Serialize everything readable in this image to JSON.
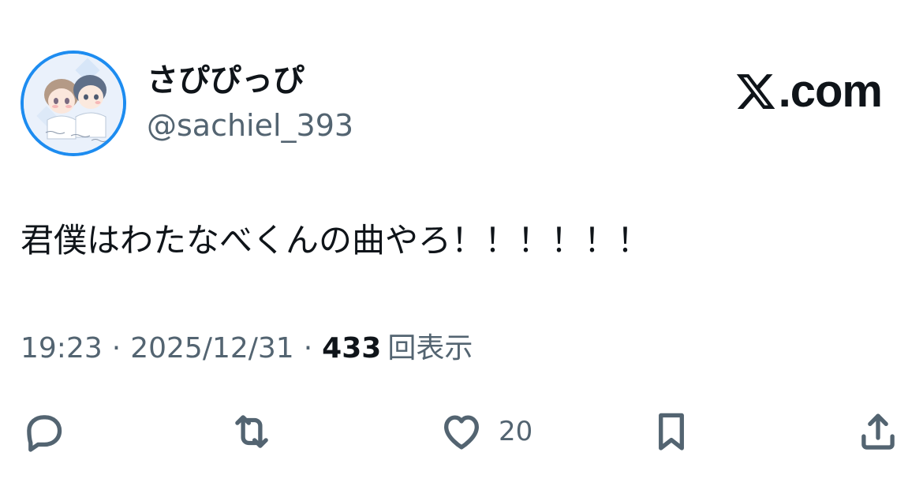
{
  "author": {
    "display_name": "さぴぴっぴ",
    "handle": "@sachiel_393",
    "avatar_icon": "profile-avatar-illustration"
  },
  "brand": {
    "logo_icon": "x-logo-icon",
    "domain": ".com"
  },
  "tweet": {
    "text": "君僕はわたなべくんの曲やろ！！！！！！"
  },
  "meta": {
    "time": "19:23",
    "separator": "·",
    "date": "2025/12/31",
    "views_count": "433",
    "views_label": "回表示"
  },
  "actions": {
    "reply": {
      "icon": "reply-icon"
    },
    "retweet": {
      "icon": "retweet-icon"
    },
    "like": {
      "icon": "heart-icon",
      "count": "20"
    },
    "bookmark": {
      "icon": "bookmark-icon"
    },
    "share": {
      "icon": "share-icon"
    }
  },
  "colors": {
    "text_primary": "#0f1419",
    "text_secondary": "#536471",
    "avatar_ring": "#1d8cf0",
    "background": "#ffffff"
  }
}
